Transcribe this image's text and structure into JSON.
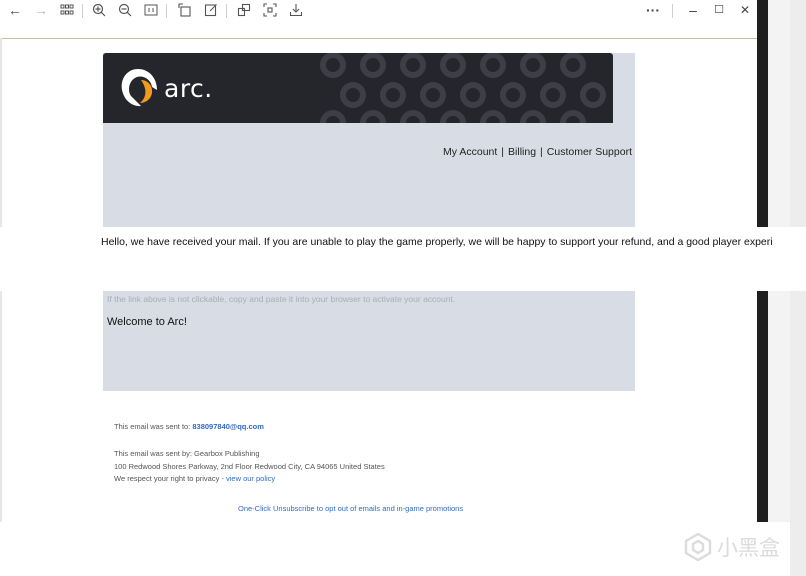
{
  "toolbar": {
    "back": "←",
    "forward": "→",
    "more": "···",
    "minimize": "–",
    "maximize": "☐",
    "close": "✕"
  },
  "email": {
    "logo_text": "arc.",
    "nav": [
      "My Account",
      "Billing",
      "Customer Support"
    ],
    "nav_separator": "|",
    "overlay_message": "Hello, we have received your mail. If you are unable to play the game properly, we will be happy to support your refund, and a good player experi",
    "link_hint": "If the link above is not clickable, copy and paste it into your browser to activate your account.",
    "welcome": "Welcome to Arc!",
    "sent_to_label": "This email was sent to: ",
    "sent_to_email": "838097840@qq.com",
    "sent_by": "This email was sent by: Gearbox Publishing",
    "address": "100 Redwood Shores Parkway, 2nd Floor Redwood City, CA 94065 United States",
    "privacy_prefix": "We respect your right to privacy - ",
    "privacy_link": "view our policy",
    "unsubscribe": "One-Click Unsubscribe to opt out of emails and in-game promotions"
  },
  "watermark": {
    "text": "小黑盒"
  },
  "colors": {
    "email_bg": "#d8dde5",
    "banner_bg": "#25262b",
    "link": "#2f6cc7"
  }
}
